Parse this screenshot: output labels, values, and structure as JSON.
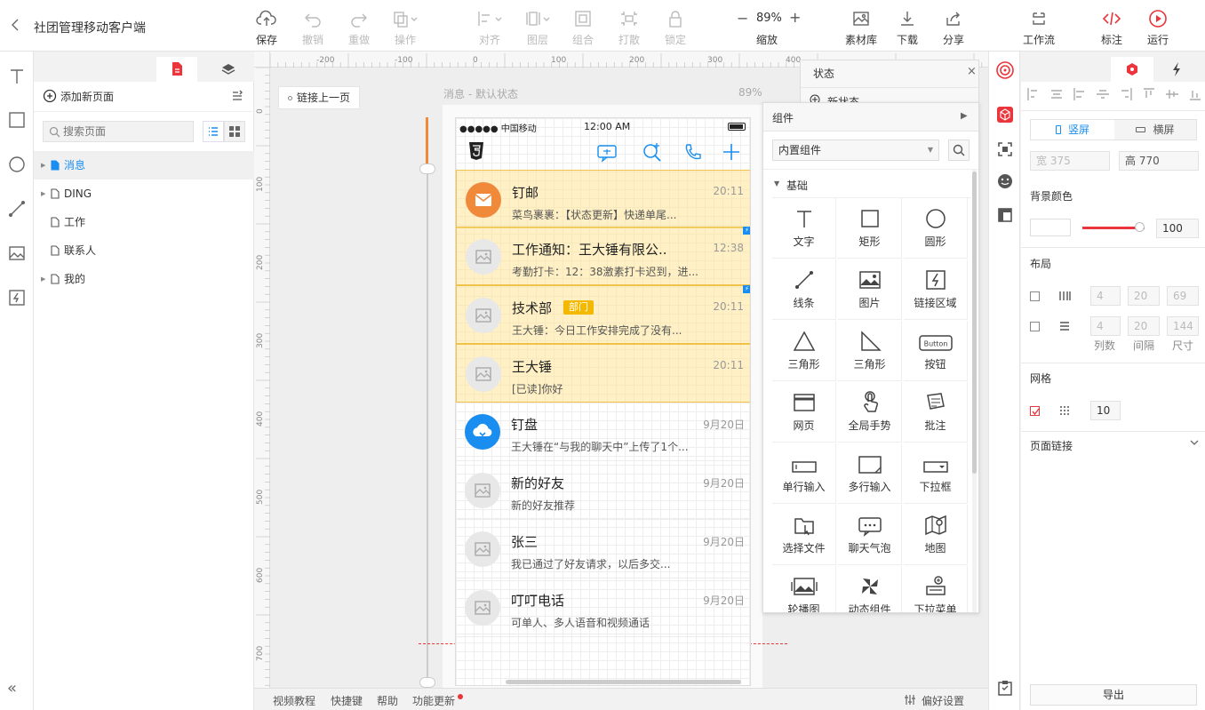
{
  "app": {
    "title": "社团管理移动客户端"
  },
  "toolbar": {
    "save": "保存",
    "undo": "撤销",
    "redo": "重做",
    "operate": "操作",
    "align": "对齐",
    "layer": "图层",
    "group": "组合",
    "ungroup": "打散",
    "lock": "锁定",
    "zoom_value": "89%",
    "zoom_label": "缩放",
    "assets": "素材库",
    "download": "下载",
    "share": "分享",
    "workflow": "工作流",
    "annotate": "标注",
    "run": "运行"
  },
  "pages": {
    "add_page": "添加新页面",
    "search_placeholder": "搜索页面",
    "items": [
      {
        "label": "消息",
        "selected": true,
        "expandable": true
      },
      {
        "label": "DING",
        "expandable": true
      },
      {
        "label": "工作"
      },
      {
        "label": "联系人"
      },
      {
        "label": "我的",
        "expandable": true
      }
    ]
  },
  "canvas": {
    "link_prev": "链接上一页",
    "page_state": "消息 - 默认状态",
    "page_zoom": "89%",
    "ruler_h": [
      "-200",
      "-100",
      "0",
      "100",
      "200",
      "300",
      "400"
    ],
    "ruler_v": [
      "0",
      "100",
      "200",
      "300",
      "400",
      "500",
      "600",
      "700"
    ]
  },
  "phone": {
    "carrier": "●●●●● 中国移动",
    "time": "12:00 AM",
    "messages": [
      {
        "title": "钉邮",
        "sub": "菜鸟裹裹：【状态更新】快递单尾...",
        "time": "20:11",
        "avatar": "mail-icon",
        "color": "#f08a3a"
      },
      {
        "title": "工作通知：王大锤有限公..",
        "sub": "考勤打卡：12：38激素打卡迟到，进...",
        "time": "12:38",
        "avatar": "image-placeholder-icon"
      },
      {
        "title": "技术部",
        "badge": "部门",
        "sub": "王大锤：今日工作安排完成了没有...",
        "time": "20:11",
        "avatar": "image-placeholder-icon"
      },
      {
        "title": "王大锤",
        "sub": "[已读]你好",
        "time": "20:11",
        "avatar": "image-placeholder-icon"
      },
      {
        "title": "钉盘",
        "sub": "王大锤在“与我的聊天中”上传了1个...",
        "time": "9月20日",
        "avatar": "cloud-icon",
        "color": "#1a8ef0"
      },
      {
        "title": "新的好友",
        "sub": "新的好友推荐",
        "time": "9月20日",
        "avatar": "image-placeholder-icon"
      },
      {
        "title": "张三",
        "sub": "我已通过了好友请求，以后多交...",
        "time": "9月20日",
        "avatar": "image-placeholder-icon"
      },
      {
        "title": "叮叮电话",
        "sub": "可单人、多人语音和视频通话",
        "time": "9月20日",
        "avatar": "image-placeholder-icon"
      }
    ]
  },
  "state_panel": {
    "title": "状态",
    "new_state": "新状态"
  },
  "components": {
    "title": "组件",
    "select": "内置组件",
    "section": "基础",
    "items": [
      "文字",
      "矩形",
      "圆形",
      "线条",
      "图片",
      "链接区域",
      "三角形",
      "三角形",
      "按钮",
      "网页",
      "全局手势",
      "批注",
      "单行输入",
      "多行输入",
      "下拉框",
      "选择文件",
      "聊天气泡",
      "地图",
      "轮播图",
      "动态组件",
      "下拉菜单"
    ],
    "button_icon_text": "Button"
  },
  "props": {
    "portrait": "竖屏",
    "landscape": "横屏",
    "width_label": "宽",
    "width": "375",
    "height_label": "高",
    "height": "770",
    "bg_color": "背景颜色",
    "opacity": "100",
    "layout": "布局",
    "layout_row1": [
      "4",
      "20",
      "69"
    ],
    "layout_row2": [
      "4",
      "20",
      "144"
    ],
    "layout_labels": [
      "列数",
      "间隔",
      "尺寸"
    ],
    "grid": "网格",
    "grid_size": "10",
    "page_link": "页面链接",
    "export": "导出"
  },
  "bottom": {
    "video": "视频教程",
    "shortcut": "快捷键",
    "help": "帮助",
    "update": "功能更新",
    "prefs": "偏好设置"
  },
  "colors": {
    "accent": "#1a8ef0",
    "selection": "#f0c24a",
    "brand_red": "#e9353b",
    "mail_orange": "#f08a3a"
  }
}
